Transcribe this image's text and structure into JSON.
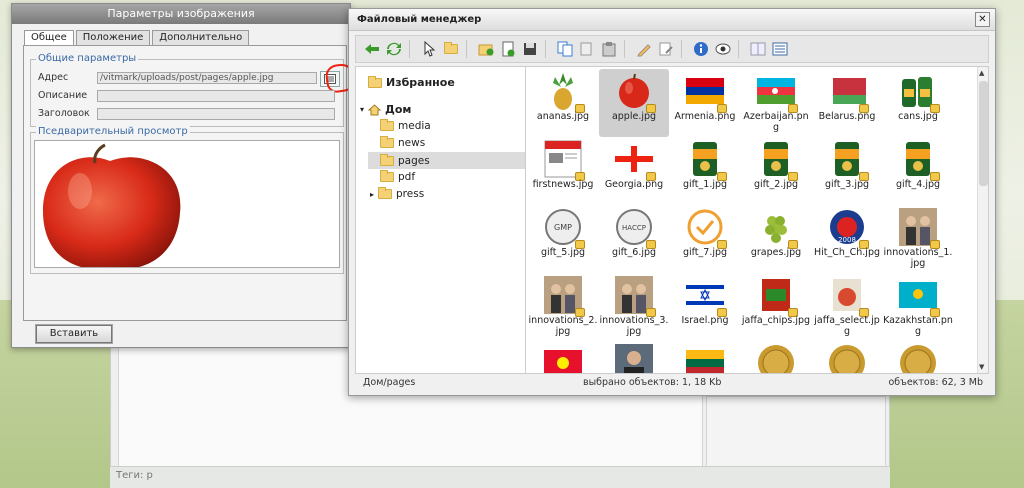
{
  "image_dialog": {
    "title": "Параметры изображения",
    "tabs": [
      "Общее",
      "Положение",
      "Дополнительно"
    ],
    "general_legend": "Общие параметры",
    "address_label": "Адрес",
    "address_value": "/vitmark/uploads/post/pages/apple.jpg",
    "description_label": "Описание",
    "description_value": "",
    "heading_label": "Заголовок",
    "heading_value": "",
    "preview_legend": "Пседварительный просмотр",
    "insert_label": "Вставить"
  },
  "editor": {
    "tags_label": "Теги: p"
  },
  "file_manager": {
    "title": "Файловый менеджер",
    "close_label": "✕",
    "favorites_label": "Избранное",
    "home_label": "Дом",
    "folders": [
      "media",
      "news",
      "pages",
      "pdf",
      "press"
    ],
    "selected_folder": "pages",
    "files": [
      {
        "name": "ananas.jpg",
        "icon": "pineapple"
      },
      {
        "name": "apple.jpg",
        "icon": "apple",
        "selected": true
      },
      {
        "name": "Armenia.png",
        "icon": "flag-armenia"
      },
      {
        "name": "Azerbaijan.png",
        "icon": "flag-azerbaijan"
      },
      {
        "name": "Belarus.png",
        "icon": "flag-belarus"
      },
      {
        "name": "cans.jpg",
        "icon": "cans"
      },
      {
        "name": "firstnews.jpg",
        "icon": "newspaper"
      },
      {
        "name": "Georgia.png",
        "icon": "flag-georgia"
      },
      {
        "name": "gift_1.jpg",
        "icon": "jaffa-can"
      },
      {
        "name": "gift_2.jpg",
        "icon": "jaffa-can"
      },
      {
        "name": "gift_3.jpg",
        "icon": "jaffa-can"
      },
      {
        "name": "gift_4.jpg",
        "icon": "jaffa-can"
      },
      {
        "name": "gift_5.jpg",
        "icon": "gmp-seal"
      },
      {
        "name": "gift_6.jpg",
        "icon": "haccp-seal"
      },
      {
        "name": "gift_7.jpg",
        "icon": "check-seal"
      },
      {
        "name": "grapes.jpg",
        "icon": "grapes"
      },
      {
        "name": "Hit_Ch_Ch.jpg",
        "icon": "hit-badge"
      },
      {
        "name": "innovations_1.jpg",
        "icon": "photo-people"
      },
      {
        "name": "innovations_2.jpg",
        "icon": "photo-people"
      },
      {
        "name": "innovations_3.jpg",
        "icon": "photo-people"
      },
      {
        "name": "Israel.png",
        "icon": "flag-israel"
      },
      {
        "name": "jaffa_chips.jpg",
        "icon": "chips"
      },
      {
        "name": "jaffa_select.jpg",
        "icon": "jaffa-select"
      },
      {
        "name": "Kazakhstan.png",
        "icon": "flag-kazakhstan"
      },
      {
        "name": "",
        "icon": "flag-kyrgyzstan"
      },
      {
        "name": "",
        "icon": "photo-man"
      },
      {
        "name": "",
        "icon": "flag-lithuania"
      },
      {
        "name": "",
        "icon": "coin"
      },
      {
        "name": "",
        "icon": "coin"
      },
      {
        "name": "",
        "icon": "coin"
      }
    ],
    "status_path": "Дом/pages",
    "status_selected": "выбрано объектов: 1, 18 Kb",
    "status_total": "объектов: 62, 3 Mb"
  }
}
